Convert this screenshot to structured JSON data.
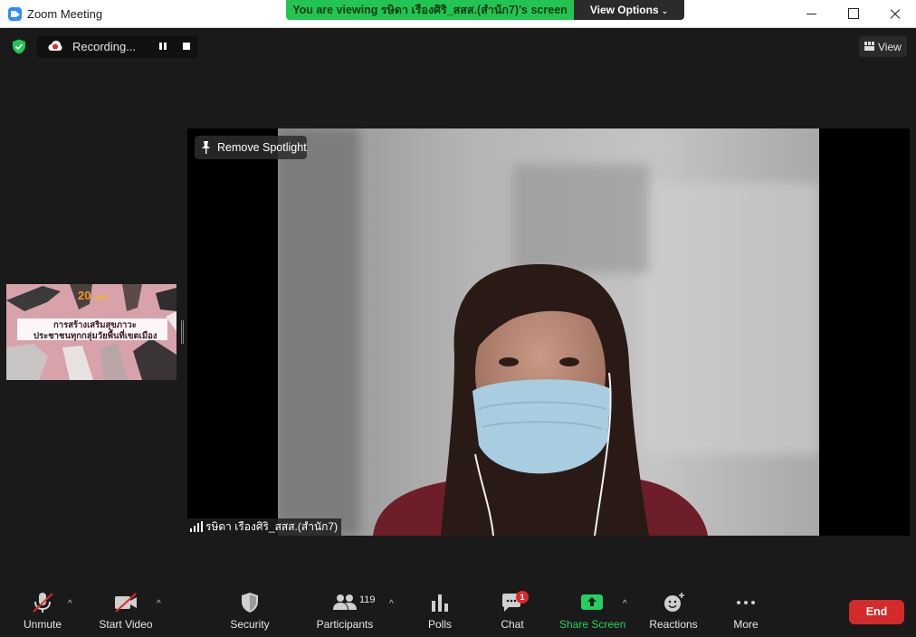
{
  "window": {
    "title": "Zoom Meeting"
  },
  "banner": {
    "viewing_text": "You are viewing รษิดา เรืองศิริ_สสส.(สำนัก7)'s screen",
    "view_options": "View Options",
    "color": "#23c552"
  },
  "recording": {
    "label": "Recording..."
  },
  "view": {
    "label": "View"
  },
  "thumbnail": {
    "logo_number": "20",
    "logo_text": "สสส",
    "line1": "การสร้างเสริมสุขภาวะ",
    "line2": "ประชาชนทุกกลุ่มวัยพื้นที่เขตเมือง"
  },
  "main_video": {
    "spotlight_label": "Remove Spotlight",
    "participant_name": "รษิดา เรืองศิริ_สสส.(สำนัก7)"
  },
  "toolbar": {
    "unmute": "Unmute",
    "start_video": "Start Video",
    "security": "Security",
    "participants": "Participants",
    "participants_count": "119",
    "polls": "Polls",
    "chat": "Chat",
    "chat_badge": "1",
    "share_screen": "Share Screen",
    "reactions": "Reactions",
    "more": "More",
    "end": "End",
    "share_color": "#23d160",
    "end_color": "#d42a2a"
  }
}
